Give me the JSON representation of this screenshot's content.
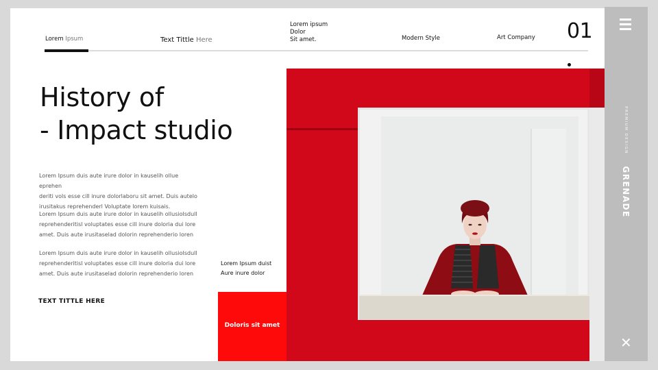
{
  "nav": {
    "item1_dark": "Lorem",
    "item1_light": " Ipsum",
    "item2_dark": "Text Tittle",
    "item2_light": " Here",
    "item3_line1": "Lorem ipsum",
    "item3_line2": "Dolor",
    "item3_line3": "Sit amet.",
    "item4": "Modern Style",
    "item5": "Art Company",
    "page_number": "01"
  },
  "title": {
    "line1": "History of",
    "line2": "- Impact studio"
  },
  "paragraphs": [
    {
      "line1": "Lorem  Ipsum duis aute irure dolor in kauselih ollue eprehen",
      "line2": "deriti vols esse cill inure dolorlaboru sit amet. Duis autelo",
      "line3": "irusitakus reprehenderl Voluptate lorem kuisais."
    },
    {
      "line1": "Lorem  Ipsum duis aute irure dolor in kauselih ollusioIsdull",
      "line2": "reprehenderitisl voluptates esse cill inure doloria dui lore",
      "line3": "amet. Duis aute irusitaselad dolorin reprehenderio loren"
    },
    {
      "line1": "Lorem  Ipsum duis aute irure dolor in kauselih ollusioIsdull",
      "line2": "reprehenderitisl voluptates esse cill inure doloria dui lore",
      "line3": "amet. Duis aute irusitaselad dolorin reprehenderio loren"
    }
  ],
  "text_title": "TEXT TITTLE HERE",
  "caption": {
    "line1": "Lorem Ipsum  duist",
    "line2": "Aure inure dolor"
  },
  "red_button": "Doloris sit amet",
  "sidebar": {
    "small_label": "PREMIUM DESIGN",
    "big_label": "GRENADE",
    "menu_icon": "hamburger-menu-icon",
    "close_icon": "close-icon"
  },
  "colors": {
    "accent": "#ff0a0a",
    "photo_red": "#d1081a",
    "sidebar": "#bdbdbd"
  }
}
